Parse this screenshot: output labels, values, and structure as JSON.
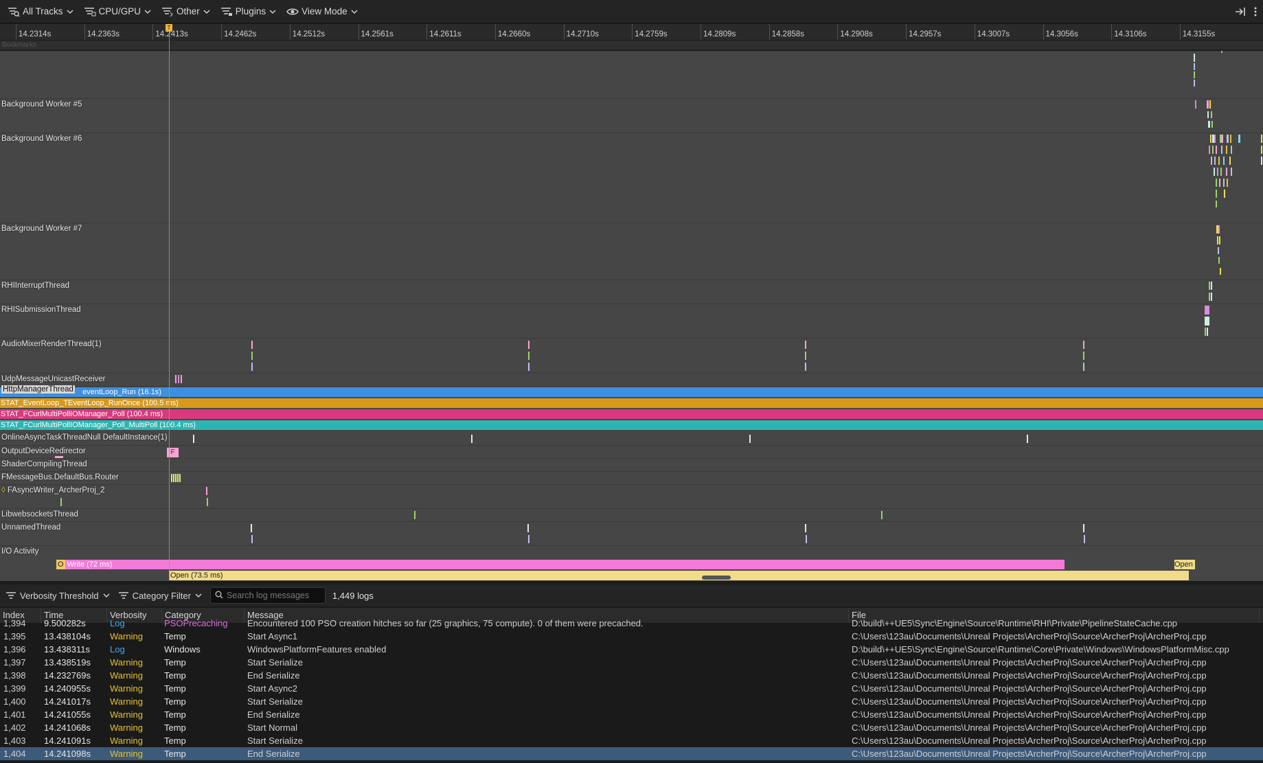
{
  "toolbar": {
    "buttons": [
      {
        "label": "All Tracks",
        "icon": "tracks-filter-icon"
      },
      {
        "label": "CPU/GPU",
        "icon": "cpu-gpu-icon"
      },
      {
        "label": "Other",
        "icon": "other-icon"
      },
      {
        "label": "Plugins",
        "icon": "plugins-icon"
      },
      {
        "label": "View Mode",
        "icon": "eye-icon"
      }
    ],
    "right_icons": [
      "dock-right-icon",
      "more-vertical-icon"
    ]
  },
  "ruler": {
    "ticks": [
      "14.2314s",
      "14.2363s",
      "14.2413s",
      "14.2462s",
      "14.2512s",
      "14.2561s",
      "14.2611s",
      "14.2660s",
      "14.2710s",
      "14.2759s",
      "14.2809s",
      "14.2858s",
      "14.2908s",
      "14.2957s",
      "14.3007s",
      "14.3056s",
      "14.3106s",
      "14.3155s"
    ],
    "cursor_label": "T"
  },
  "bookmarks_label": "Bookmarks",
  "tracks": [
    {
      "name": "Background Worker #5"
    },
    {
      "name": "Background Worker #6"
    },
    {
      "name": "Background Worker #7"
    },
    {
      "name": "RHIInterruptThread"
    },
    {
      "name": "RHISubmissionThread"
    },
    {
      "name": "AudioMixerRenderThread(1)"
    },
    {
      "name": "UdpMessageUnicastReceiver"
    },
    {
      "name": "HttpManagerThread"
    },
    {
      "name": "OnlineAsyncTaskThreadNull DefaultInstance(1)"
    },
    {
      "name": "OutputDeviceRedirector"
    },
    {
      "name": "ShaderCompilingThread"
    },
    {
      "name": "FMessageBus.DefaultBus.Router"
    },
    {
      "name": "FAsyncWriter_ArcherProj_2"
    },
    {
      "name": "LibwebsocketsThread"
    },
    {
      "name": "UnnamedThread"
    },
    {
      "name": "I/O Activity"
    }
  ],
  "http_bars": [
    {
      "label": "eventLoop_Run (16.1s)",
      "color": "#3d8fe0"
    },
    {
      "label": "STAT_EventLoop_TEventLoop_RunOnce (100.5 ms)",
      "color": "#d79a1c"
    },
    {
      "label": "STAT_FCurlMultiPollIOManager_Poll (100.4 ms)",
      "color": "#d93a7d"
    },
    {
      "label": "STAT_FCurlMultiPollIOManager_Poll_MultiPoll (100.4 ms)",
      "color": "#2bb6b3"
    }
  ],
  "output_marker": "F",
  "io": {
    "write_prefix": "O",
    "write_label": "Write (72 ms)",
    "open_label": "Open (73.5 ms)",
    "open_small_label": "Open"
  },
  "logbar": {
    "verbosity_label": "Verbosity Threshold",
    "category_label": "Category Filter",
    "search_placeholder": "Search log messages",
    "count": "1,449 logs"
  },
  "log_columns": [
    "Index",
    "Time",
    "Verbosity",
    "Category",
    "Message",
    "File"
  ],
  "log_rows": [
    {
      "index": "1,394",
      "time": "9.500282s",
      "verbosity": "Log",
      "category": "PSOPrecaching",
      "message": "Encountered 100 PSO creation hitches so far (25 graphics, 75 compute). 0 of them were precached.",
      "file": "D:\\build\\++UE5\\Sync\\Engine\\Source\\Runtime\\RHI\\Private\\PipelineStateCache.cpp"
    },
    {
      "index": "1,395",
      "time": "13.438104s",
      "verbosity": "Warning",
      "category": "Temp",
      "message": "Start Async1",
      "file": "C:\\Users\\123au\\Documents\\Unreal Projects\\ArcherProj\\Source\\ArcherProj\\ArcherProj.cpp"
    },
    {
      "index": "1,396",
      "time": "13.438311s",
      "verbosity": "Log",
      "category": "Windows",
      "message": "WindowsPlatformFeatures enabled",
      "file": "D:\\build\\++UE5\\Sync\\Engine\\Source\\Runtime\\Core\\Private\\Windows\\WindowsPlatformMisc.cpp"
    },
    {
      "index": "1,397",
      "time": "13.438519s",
      "verbosity": "Warning",
      "category": "Temp",
      "message": "Start Serialize",
      "file": "C:\\Users\\123au\\Documents\\Unreal Projects\\ArcherProj\\Source\\ArcherProj\\ArcherProj.cpp"
    },
    {
      "index": "1,398",
      "time": "14.232769s",
      "verbosity": "Warning",
      "category": "Temp",
      "message": "End Serialize",
      "file": "C:\\Users\\123au\\Documents\\Unreal Projects\\ArcherProj\\Source\\ArcherProj\\ArcherProj.cpp"
    },
    {
      "index": "1,399",
      "time": "14.240955s",
      "verbosity": "Warning",
      "category": "Temp",
      "message": "Start Async2",
      "file": "C:\\Users\\123au\\Documents\\Unreal Projects\\ArcherProj\\Source\\ArcherProj\\ArcherProj.cpp"
    },
    {
      "index": "1,400",
      "time": "14.241017s",
      "verbosity": "Warning",
      "category": "Temp",
      "message": "Start Serialize",
      "file": "C:\\Users\\123au\\Documents\\Unreal Projects\\ArcherProj\\Source\\ArcherProj\\ArcherProj.cpp"
    },
    {
      "index": "1,401",
      "time": "14.241055s",
      "verbosity": "Warning",
      "category": "Temp",
      "message": "End Serialize",
      "file": "C:\\Users\\123au\\Documents\\Unreal Projects\\ArcherProj\\Source\\ArcherProj\\ArcherProj.cpp"
    },
    {
      "index": "1,402",
      "time": "14.241068s",
      "verbosity": "Warning",
      "category": "Temp",
      "message": "Start Normal",
      "file": "C:\\Users\\123au\\Documents\\Unreal Projects\\ArcherProj\\Source\\ArcherProj\\ArcherProj.cpp"
    },
    {
      "index": "1,403",
      "time": "14.241091s",
      "verbosity": "Warning",
      "category": "Temp",
      "message": "Start Serialize",
      "file": "C:\\Users\\123au\\Documents\\Unreal Projects\\ArcherProj\\Source\\ArcherProj\\ArcherProj.cpp"
    },
    {
      "index": "1,404",
      "time": "14.241098s",
      "verbosity": "Warning",
      "category": "Temp",
      "message": "End Serialize",
      "file": "C:\\Users\\123au\\Documents\\Unreal Projects\\ArcherProj\\Source\\ArcherProj\\ArcherProj.cpp",
      "selected": true
    }
  ],
  "colors": {
    "warning": "#e8c22e",
    "log": "#3ea9ef",
    "psoprecaching": "#d56fd8",
    "selected_row": "#3c5a7a"
  }
}
